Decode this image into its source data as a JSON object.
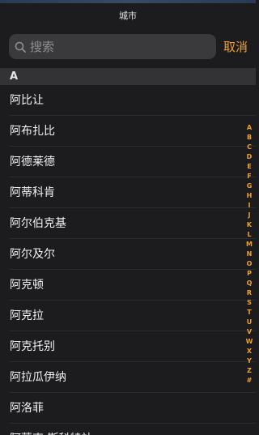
{
  "header": {
    "title": "城市"
  },
  "search": {
    "placeholder": "搜索",
    "value": "",
    "cancel_label": "取消"
  },
  "section": {
    "label": "A"
  },
  "cities": [
    "阿比让",
    "阿布扎比",
    "阿德莱德",
    "阿蒂科肯",
    "阿尔伯克基",
    "阿尔及尔",
    "阿克顿",
    "阿克拉",
    "阿克托别",
    "阿拉瓜伊纳",
    "阿洛菲",
    "阿蒙克 斯科特站"
  ],
  "index_letters": [
    "A",
    "B",
    "C",
    "D",
    "E",
    "F",
    "G",
    "H",
    "I",
    "J",
    "K",
    "L",
    "M",
    "N",
    "O",
    "P",
    "Q",
    "R",
    "S",
    "T",
    "U",
    "V",
    "W",
    "X",
    "Y",
    "Z",
    "#"
  ],
  "colors": {
    "accent": "#f0a030",
    "background": "#1c1c1e"
  }
}
